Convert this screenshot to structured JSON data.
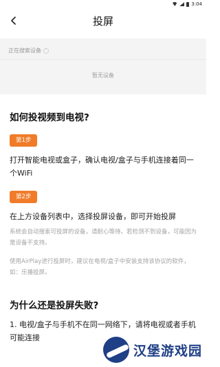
{
  "status_bar": {
    "time": "3:04"
  },
  "nav": {
    "title": "投屏"
  },
  "search_panel": {
    "searching_text": "正在搜索设备",
    "empty_text": "暂无设备"
  },
  "help": {
    "title": "如何投视频到电视?",
    "steps": [
      {
        "badge": "第1步",
        "text": "打开智能电视或盒子，确认电视/盒子与手机连接着同一个WiFi"
      },
      {
        "badge": "第2步",
        "text": "在上方设备列表中，选择投屏设备，即可开始投屏"
      }
    ],
    "notes": [
      "系统会自动搜索可投屏的设备，请耐心等待。若检测不到设备，可能因为是设备不支持。",
      "使用AirPlay进行投屏时，建议在电视/盒子中安装支持该协议的软件，如：乐播投屏。"
    ],
    "fail_title": "为什么还是投屏失败?",
    "fail_items": [
      "1. 电视/盒子与手机不在同一网络下，请将电视或者手机可能连接"
    ]
  },
  "watermark": {
    "text": "汉堡游戏园"
  },
  "icons": {
    "back": "back-arrow-icon",
    "wifi": "wifi-icon",
    "signal": "signal-icon",
    "battery": "battery-icon",
    "spinner": "loading-spinner-icon"
  },
  "colors": {
    "accent": "#f07c2a",
    "panel_bg": "#f4f4f4",
    "muted_text": "#a3a3a3",
    "watermark": "#1f3f86"
  }
}
